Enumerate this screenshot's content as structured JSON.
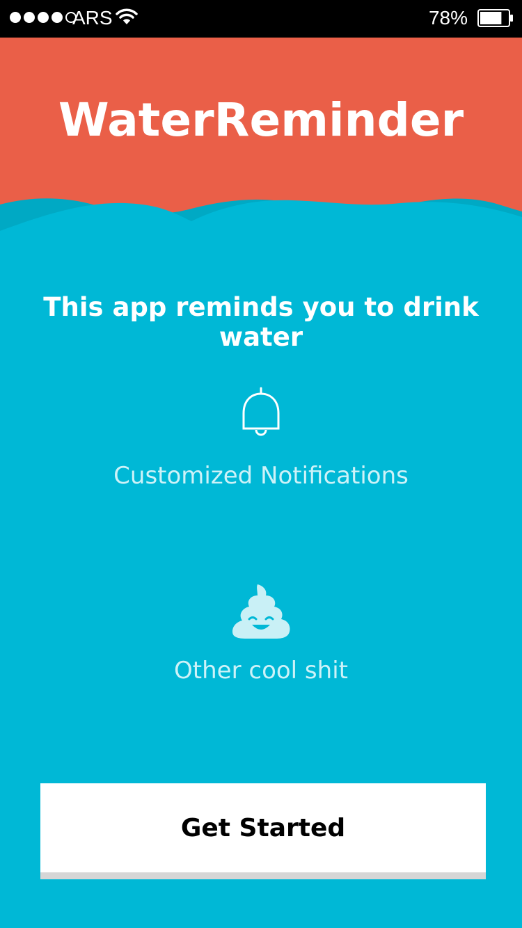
{
  "status_bar": {
    "carrier": "ARS",
    "battery_percent": "78%",
    "battery_level": 0.78,
    "signal_bars_filled": 4,
    "signal_bars_total": 5
  },
  "header": {
    "title": "WaterReminder"
  },
  "main": {
    "tagline": "This app reminds you to drink water",
    "features": [
      {
        "icon": "bell-icon",
        "label": "Customized Notifications"
      },
      {
        "icon": "poo-emoji-icon",
        "label": "Other cool shit"
      }
    ]
  },
  "cta": {
    "label": "Get Started"
  },
  "colors": {
    "header_bg": "#ea5f48",
    "body_bg": "#00b8d6",
    "wave_dark": "#00a9c4",
    "feature_text": "#cdf2f8",
    "button_bg": "#ffffff"
  }
}
